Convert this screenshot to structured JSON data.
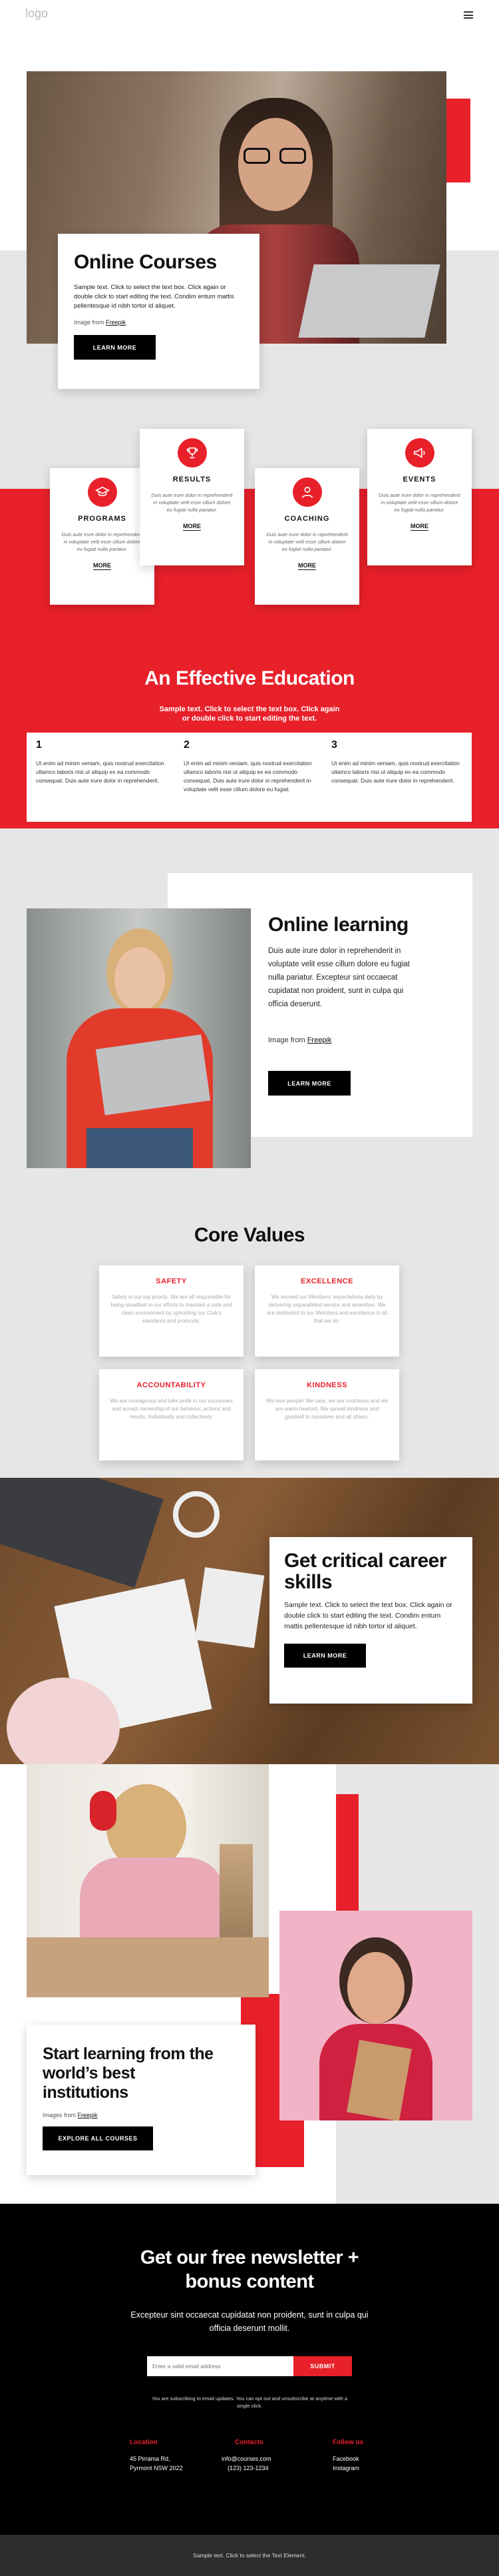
{
  "header": {
    "logo": "logo",
    "menu_icon": "hamburger-menu-icon"
  },
  "hero": {
    "title": "Online Courses",
    "text": "Sample text. Click to select the text box. Click again or double click to start editing the text. Condim entum mattis pellentesque id nibh tortor id aliquet.",
    "credit_prefix": "Image from ",
    "credit_link": "Freepik",
    "button": "LEARN MORE"
  },
  "features": [
    {
      "title": "PROGRAMS",
      "text": "Duis aute irure dolor in reprehenderit in voluptate velit esse cillum dolore eu fugiat nulla pariatur.",
      "more": "MORE",
      "icon": "mortarboard-icon"
    },
    {
      "title": "RESULTS",
      "text": "Duis aute irure dolor in reprehenderit in voluptate velit esse cillum dolore eu fugiat nulla pariatur.",
      "more": "MORE",
      "icon": "trophy-icon"
    },
    {
      "title": "COACHING",
      "text": "Duis aute irure dolor in reprehenderit in voluptate velit esse cillum dolore eu fugiat nulla pariatur.",
      "more": "MORE",
      "icon": "person-icon"
    },
    {
      "title": "EVENTS",
      "text": "Duis aute irure dolor in reprehenderit in voluptate velit esse cillum dolore eu fugiat nulla pariatur.",
      "more": "MORE",
      "icon": "megaphone-icon"
    }
  ],
  "education": {
    "title": "An Effective Education",
    "subtitle": "Sample text. Click to select the text box. Click again or double click to start editing the text.",
    "steps": [
      {
        "num": "1",
        "text": "Ut enim ad minim veniam, quis nostrud exercitation ullamco laboris nisi ut aliquip ex ea commodo consequat. Duis aute irure dolor in reprehenderit."
      },
      {
        "num": "2",
        "text": "Ut enim ad minim veniam, quis nostrud exercitation ullamco laboris nisi ut aliquip ex ea commodo consequat. Duis aute irure dolor in reprehenderit in voluptate velit esse cillum dolore eu fugiat."
      },
      {
        "num": "3",
        "text": "Ut enim ad minim veniam, quis nostrud exercitation ullamco laboris nisi ut aliquip ex ea commodo consequat. Duis aute irure dolor in reprehenderit."
      }
    ]
  },
  "online": {
    "title": "Online learning",
    "text": "Duis aute irure dolor in reprehenderit in voluptate velit esse cillum dolore eu fugiat nulla pariatur. Excepteur sint occaecat cupidatat non proident, sunt in culpa qui officia deserunt.",
    "credit_prefix": "Image from ",
    "credit_link": "Freepik",
    "button": "LEARN MORE"
  },
  "values": {
    "title": "Core Values",
    "items": [
      {
        "title": "SAFETY",
        "text": "Safety is our top priority. We are all responsible for being steadfast in our efforts to maintain a safe and clean environment by upholding our Club's standards and protocols."
      },
      {
        "title": "EXCELLENCE",
        "text": "We exceed our Members' expectations daily by delivering unparalleled service and amenities. We are dedicated to our Members and excellence in all that we do."
      },
      {
        "title": "ACCOUNTABILITY",
        "text": "We are courageous and take pride in our successes and accept ownership of our behavior, actions and results. Individually and collectively."
      },
      {
        "title": "KINDNESS",
        "text": "We love people! We care, we are courteous and we are warm-hearted. We spread kindness and goodwill to ourselves and all others."
      }
    ]
  },
  "career": {
    "title": "Get critical career skills",
    "text": "Sample text. Click to select the text box. Click again or double click to start editing the text. Condim entum mattis pellentesque id nibh tortor id aliquet.",
    "button": "LEARN MORE"
  },
  "start": {
    "title": "Start learning from the world’s best institutions",
    "credit_prefix": "Images from ",
    "credit_link": "Freepik",
    "button": "EXPLORE ALL COURSES"
  },
  "newsletter": {
    "title": "Get our free newsletter + bonus content",
    "text": "Excepteur sint occaecat cupidatat non proident, sunt in culpa qui officia deserunt mollit.",
    "placeholder": "Enter a valid email address",
    "button": "SUBMIT",
    "note": "You are subscribing to email updates. You can opt out and unsubscribe at anytime with a single click."
  },
  "footer": {
    "location": {
      "title": "Location",
      "lines": [
        "45 Pirrama Rd,",
        "Pyrmont NSW 2022"
      ]
    },
    "contacts": {
      "title": "Contacts",
      "lines": [
        "info@courses.com",
        "(123) 123-1234"
      ]
    },
    "follow": {
      "title": "Follow us",
      "lines": [
        "Facebook",
        "Instagram"
      ]
    },
    "bottom": "Sample text. Click to select the Text Element."
  },
  "colors": {
    "accent": "#e8202a",
    "dark": "#000000",
    "gray": "#e6e6e6"
  }
}
